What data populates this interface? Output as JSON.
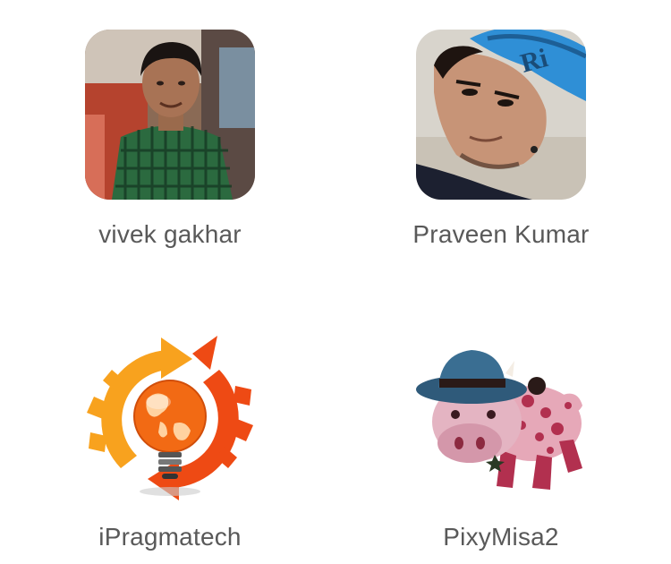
{
  "people": [
    {
      "name": "vivek gakhar",
      "avatar_icon": "person-photo-icon"
    },
    {
      "name": "Praveen Kumar",
      "avatar_icon": "person-selfie-photo-icon"
    },
    {
      "name": "iPragmatech",
      "avatar_icon": "globe-lightbulb-logo-icon"
    },
    {
      "name": "PixyMisa2",
      "avatar_icon": "toy-cow-with-hat-icon"
    }
  ],
  "colors": {
    "background": "#ffffff",
    "name_text": "#595959"
  }
}
